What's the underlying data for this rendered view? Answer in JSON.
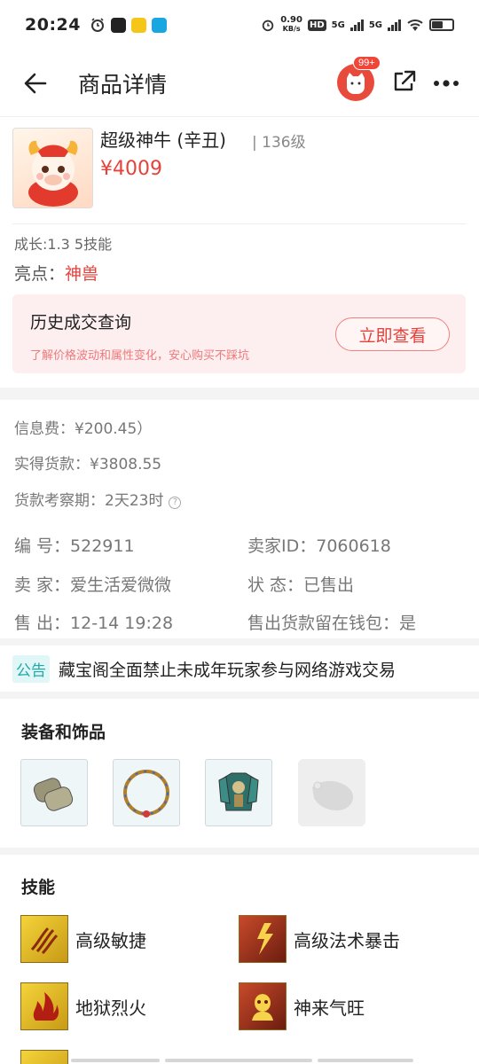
{
  "status_bar": {
    "time": "20:24",
    "net_speed_value": "0.90",
    "net_speed_unit": "KB/s",
    "hd_label": "HD",
    "sim1_label": "5G",
    "sim2_label": "5G"
  },
  "nav": {
    "title": "商品详情",
    "badge": "99+"
  },
  "product": {
    "name": "超级神牛 (辛丑)",
    "level": "| 136级",
    "price": "¥4009",
    "growth": "成长:1.3 5技能",
    "highlight_label": "亮点：",
    "highlight_value": "神兽"
  },
  "history": {
    "title": "历史成交查询",
    "subtitle": "了解价格波动和属性变化，安心购买不踩坑",
    "button": "立即查看"
  },
  "fees": {
    "info_fee": "信息费：¥200.45）",
    "received": "实得货款：¥3808.55",
    "review_period": "货款考察期：2天23时"
  },
  "details": {
    "id_label": "编    号：",
    "id_value": "522911",
    "seller_id_label": "卖家ID：",
    "seller_id_value": "7060618",
    "seller_label": "卖    家：",
    "seller_value": "爱生活爱微微",
    "status_label": "状    态：",
    "status_value": "已售出",
    "sold_label": "售    出：",
    "sold_value": "12-14 19:28",
    "wallet_label": "售出货款留在钱包：",
    "wallet_value": "是"
  },
  "notice": {
    "tag": "公告",
    "text": "藏宝阁全面禁止未成年玩家参与网络游戏交易"
  },
  "equipment": {
    "title": "装备和饰品",
    "items": [
      {
        "icon": "bracer-icon"
      },
      {
        "icon": "necklace-icon"
      },
      {
        "icon": "armor-icon"
      },
      {
        "icon": "empty-slot-icon"
      }
    ]
  },
  "skills": {
    "title": "技能",
    "items": [
      {
        "label": "高级敏捷",
        "icon": "agility-skill-icon"
      },
      {
        "label": "高级法术暴击",
        "icon": "spell-crit-skill-icon"
      },
      {
        "label": "地狱烈火",
        "icon": "hellfire-skill-icon"
      },
      {
        "label": "神来气旺",
        "icon": "divine-spirit-skill-icon"
      }
    ]
  },
  "colors": {
    "accent_red": "#e8403a",
    "notice_teal": "#1fa9a9",
    "history_bg": "#fdeef0"
  }
}
